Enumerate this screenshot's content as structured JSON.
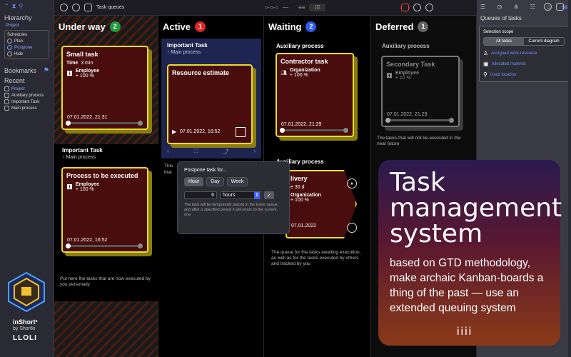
{
  "sidebar": {
    "hierarchy": "Hierarchy",
    "project": "Project",
    "schedules": "Schedules",
    "plan": "Plan",
    "postpone": "Postpone",
    "hide": "Hide",
    "bookmarks": "Bookmarks",
    "recent": "Recent",
    "recent_items": [
      "Project",
      "Auxiliary process",
      "Important Task",
      "Main process"
    ],
    "brand": "inShort²",
    "by": "by Shortki",
    "wm": "LLOLI"
  },
  "toolbar": {
    "title": "Task queues"
  },
  "columns": {
    "underway": {
      "title": "Under way",
      "count": "2",
      "note": "Put here the tasks that are now executed by you personally"
    },
    "active": {
      "title": "Active",
      "count": "1",
      "note_a": "This",
      "note_b": "that"
    },
    "waiting": {
      "title": "Waiting",
      "count": "2",
      "note": "The queue for the tasks awaiting execution, as well as for the tasks executed by others and tracked by you"
    },
    "deferred": {
      "title": "Deferred",
      "count": "1",
      "note": "The tasks that will not be executed in the near future"
    }
  },
  "cards": {
    "small": {
      "title": "Small task",
      "time_label": "Time",
      "time_val": "3 min",
      "who": "Employee",
      "pct": "+ 100 %",
      "date": "07.01.2022, 21:31"
    },
    "important_proc": {
      "title": "Important Task",
      "sub": "↑ Main process"
    },
    "process": {
      "title": "Process to be executed",
      "who": "Employee",
      "pct": "+ 100 %",
      "date": "07.01.2022, 16:52"
    },
    "active_proc": {
      "title": "Important Task",
      "sub": "↑ Main process"
    },
    "estimate": {
      "title": "Resource estimate",
      "date": "07.01.2022, 16:52"
    },
    "aux_proc": {
      "title": "Auxiliary process"
    },
    "contractor": {
      "title": "Contractor task",
      "who": "Organization",
      "pct": "+ 100 %",
      "date": "07.01.2022, 21:29"
    },
    "aux_proc2": {
      "title": "Auxiliary process"
    },
    "delivery": {
      "title": "livery",
      "time": "e 30 d",
      "who": "Organization",
      "pct": "+ 100 %",
      "date": "07.01.2022"
    },
    "def_proc": {
      "title": "Auxiliary process"
    },
    "secondary": {
      "title": "Secondary Task",
      "who": "Employee",
      "pct": "+ 10 %",
      "date": "07.01.2022, 21:29"
    }
  },
  "popover": {
    "title": "Postpone task for...",
    "chips": [
      "Hour",
      "Day",
      "Week"
    ],
    "number": "6",
    "unit": "hours",
    "ok": "✓",
    "hint": "The task will be temporarily placed in the lower queue, and after a specified period it will return to the current one"
  },
  "rightpanel": {
    "title": "Queues of tasks",
    "scope": "Selection scope",
    "seg": [
      "All tasks",
      "Current diagram"
    ],
    "links": [
      "Assigned work resource",
      "Allocated material",
      "Used location"
    ]
  },
  "promo": {
    "big": "Task management system",
    "small": "based on GTD methodology, make archaic Kanban-boards a thing of the past — use an extended queuing system",
    "dots": "iiii"
  },
  "colors": {
    "badge_green": "#1f9d3a",
    "badge_red": "#e0262b",
    "badge_blue": "#2f5cf0",
    "badge_gray": "#666666",
    "card_border": "#e8de2a"
  }
}
